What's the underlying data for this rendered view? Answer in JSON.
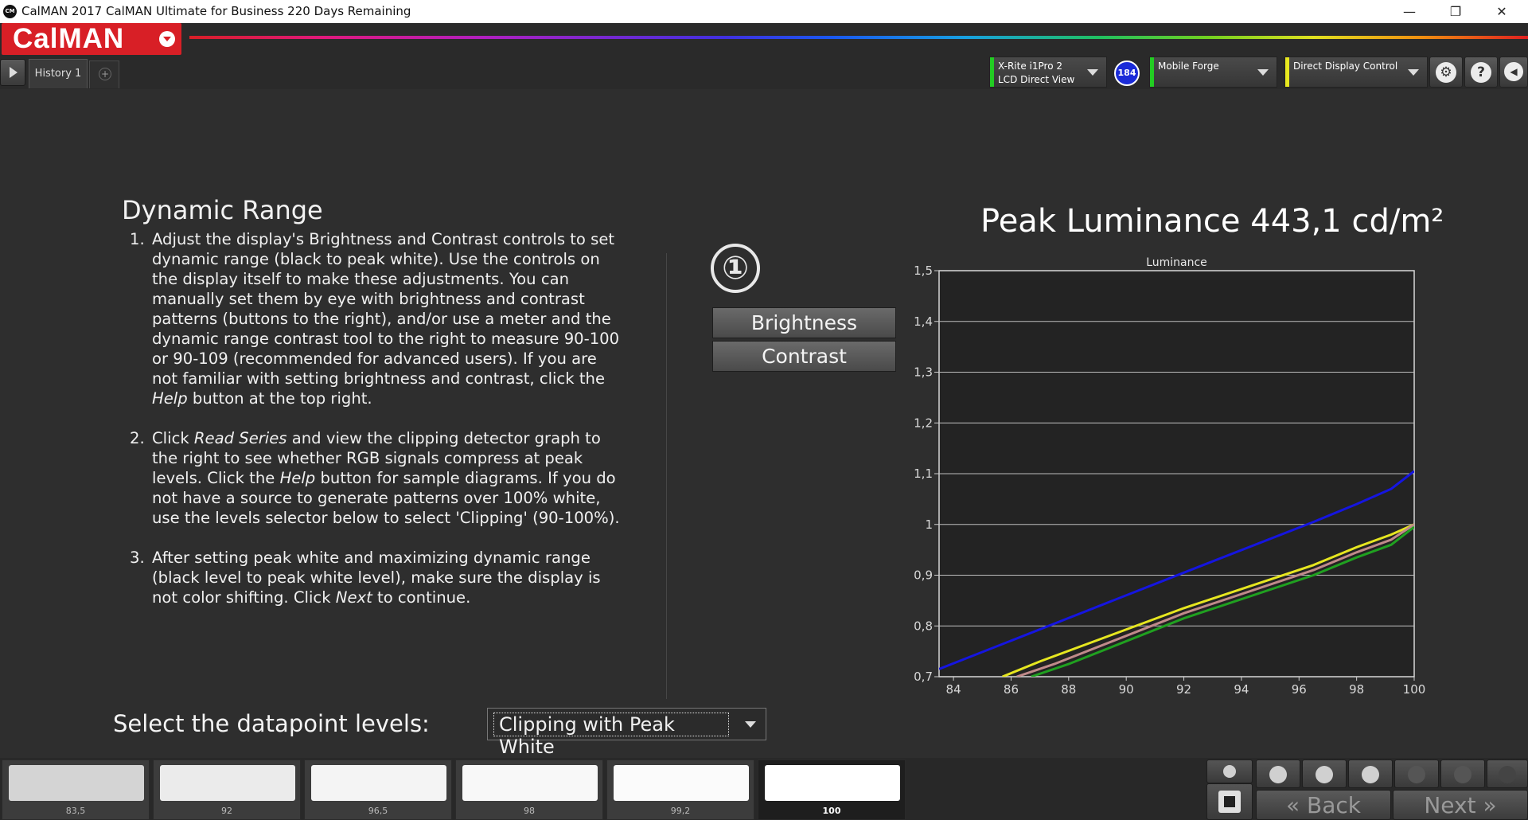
{
  "titlebar": {
    "title": "CalMAN 2017 CalMAN Ultimate for Business 220 Days Remaining",
    "app_icon_text": "CM",
    "minimize": "—",
    "maximize": "❐",
    "close": "✕"
  },
  "brand": {
    "logo": "CalMAN"
  },
  "tabs": {
    "history": "History 1",
    "add": "+"
  },
  "devices": {
    "meter": {
      "line1": "X-Rite i1Pro 2",
      "line2": "LCD Direct View",
      "stripe_color": "#22cc22"
    },
    "meter_badge": "184",
    "source": {
      "line1": "Mobile Forge",
      "stripe_color": "#22cc22"
    },
    "display": {
      "line1": "Direct Display Control",
      "stripe_color": "#e8e820"
    }
  },
  "toolbar": {
    "settings_glyph": "⚙",
    "help_glyph": "?",
    "collapse_glyph": "◀"
  },
  "content": {
    "heading": "Dynamic Range",
    "steps": [
      {
        "num": "1.",
        "text": "Adjust the display's Brightness and Contrast controls to set dynamic range (black to peak white). Use the controls on the display itself to make these adjustments. You can manually set them by eye with brightness and contrast patterns (buttons to the right), and/or use a meter and the dynamic range contrast tool to the right to measure 90-100 or 90-109 (recommended for advanced users). If you are not familiar with setting brightness and contrast, click the ",
        "em": "Help",
        "tail": " button at the top right."
      },
      {
        "num": "2.",
        "pre": "Click ",
        "em1": "Read Series",
        "mid1": " and view the clipping detector graph to the right to see whether RGB signals compress at peak levels. Click the ",
        "em2": "Help",
        "mid2": " button for sample diagrams. If you do not have a source to generate patterns over 100% white, use the levels selector below to select 'Clipping' (90-100%)."
      },
      {
        "num": "3.",
        "pre": "After setting peak white and maximizing dynamic range (black level to peak white level), make sure the display is not color shifting. Click ",
        "em": "Next",
        "tail": " to continue."
      }
    ],
    "step_marker": "①",
    "brightness_button": "Brightness",
    "contrast_button": "Contrast",
    "peak_luminance": "Peak Luminance 443,1 cd/m²",
    "select_label": "Select the datapoint levels:",
    "select_value": "Clipping with Peak White"
  },
  "chart_data": {
    "type": "line",
    "title": "Luminance",
    "xlabel": "",
    "ylabel": "",
    "xlim": [
      83.5,
      100
    ],
    "ylim": [
      0.7,
      1.5
    ],
    "x_ticks": [
      "84",
      "86",
      "88",
      "90",
      "92",
      "94",
      "96",
      "98",
      "100"
    ],
    "y_ticks": [
      "0,7",
      "0,8",
      "0,9",
      "1",
      "1,1",
      "1,2",
      "1,3",
      "1,4",
      "1,5"
    ],
    "grid": "horizontal",
    "series": [
      {
        "color": "#1515e0",
        "x": [
          83.5,
          92,
          96.5,
          98,
          99.2,
          100
        ],
        "y": [
          0.715,
          0.905,
          1.005,
          1.04,
          1.07,
          1.105
        ]
      },
      {
        "color": "#e6e620",
        "x": [
          85.7,
          87,
          92,
          96.5,
          98,
          99.2,
          100
        ],
        "y": [
          0.7,
          0.73,
          0.835,
          0.92,
          0.955,
          0.98,
          1.0
        ]
      },
      {
        "color": "#c08a8a",
        "x": [
          86.2,
          87.5,
          92,
          96.5,
          98,
          99.2,
          100
        ],
        "y": [
          0.7,
          0.725,
          0.825,
          0.91,
          0.945,
          0.97,
          1.0
        ]
      },
      {
        "color": "#20a020",
        "x": [
          86.7,
          88,
          92,
          96.5,
          98,
          99.2,
          100
        ],
        "y": [
          0.7,
          0.725,
          0.815,
          0.9,
          0.935,
          0.96,
          0.995
        ]
      }
    ]
  },
  "swatches": [
    {
      "label": "83,5",
      "color": "#d4d4d4"
    },
    {
      "label": "92",
      "color": "#ebebeb"
    },
    {
      "label": "96,5",
      "color": "#f4f4f4"
    },
    {
      "label": "98",
      "color": "#f8f8f8"
    },
    {
      "label": "99,2",
      "color": "#fbfbfb"
    },
    {
      "label": "100",
      "color": "#ffffff"
    }
  ],
  "nav": {
    "back": "Back",
    "next": "Next",
    "back_glyph": "«",
    "next_glyph": "»"
  }
}
